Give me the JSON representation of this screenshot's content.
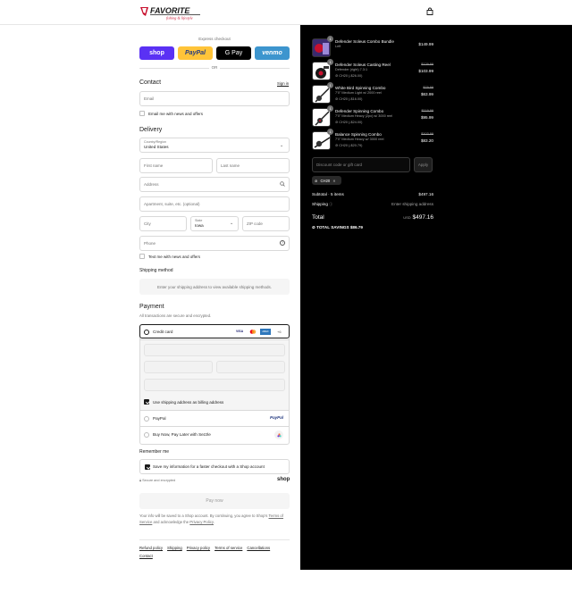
{
  "header": {
    "brand": "FAVORITE",
    "brand_sub": "fishing & lifestyle",
    "cart_icon": "bag-icon"
  },
  "express": {
    "label": "Express checkout",
    "buttons": [
      {
        "label": "shop",
        "color": "#5a31f4"
      },
      {
        "label": "PayPal",
        "color": "#ffc439"
      },
      {
        "label": "G Pay",
        "color": "#000000"
      },
      {
        "label": "venmo",
        "color": "#3d95ce"
      }
    ],
    "or": "OR"
  },
  "contact": {
    "title": "Contact",
    "signin": "Sign in",
    "email_placeholder": "Email",
    "news_label": "Email me with news and offers"
  },
  "delivery": {
    "title": "Delivery",
    "country_label": "Country/Region",
    "country_value": "United States",
    "first_name": "First name",
    "last_name": "Last name",
    "address": "Address",
    "apartment": "Apartment, suite, etc. (optional)",
    "city": "City",
    "state_label": "State",
    "state_value": "Iowa",
    "zip": "ZIP code",
    "phone": "Phone",
    "text_label": "Text me with news and offers"
  },
  "shipping": {
    "title": "Shipping method",
    "message": "Enter your shipping address to view available shipping methods."
  },
  "payment": {
    "title": "Payment",
    "subtitle": "All transactions are secure and encrypted.",
    "credit_card": "Credit card",
    "cards": [
      "VISA",
      "MC",
      "AMEX"
    ],
    "more": "+6",
    "billing_same": "Use shipping address as billing address",
    "paypal": "PayPal",
    "paypal_logo": "PayPal",
    "sezzle": "Buy Now, Pay Later with Sezzle"
  },
  "remember": {
    "title": "Remember me",
    "save_label": "Save my information for a faster checkout with a Shop account",
    "secure": "Secure and encrypted",
    "shop_logo": "shop"
  },
  "pay_now": "Pay now",
  "fine_print": {
    "line1": "Your info will be saved to a Shop account. By continuing, you agree to Shop's",
    "terms": "Terms of Service",
    "middle": "and acknowledge the",
    "privacy": "Privacy Policy",
    "end": "."
  },
  "footer": {
    "links": [
      "Refund policy",
      "Shipping",
      "Privacy policy",
      "Terms of service",
      "Cancellations",
      "Contact"
    ]
  },
  "summary": {
    "items": [
      {
        "qty": "1",
        "name": "Defender Soleus Combo Bundle",
        "variant": "Left",
        "discount": "",
        "original": "",
        "price": "$149.99"
      },
      {
        "qty": "1",
        "name": "Defender Soleus Casting Reel",
        "variant": "Defender (right) 7.3:1",
        "discount": "CH20 (-$26.00)",
        "original": "$129.99",
        "price": "$103.99"
      },
      {
        "qty": "1",
        "name": "White Bird Spinning Combo",
        "variant": "7'0\" Medium Light w/ 2000 reel",
        "discount": "CH20 (-$16.00)",
        "original": "$79.99",
        "price": "$63.99"
      },
      {
        "qty": "1",
        "name": "Defender Spinning Combo",
        "variant": "7'0\" Medium Heavy (2pc) w/ 3000 reel",
        "discount": "CH20 (-$24.00)",
        "original": "$119.99",
        "price": "$95.99"
      },
      {
        "qty": "1",
        "name": "Balance Spinning Combo",
        "variant": "7'0\" Medium Heavy w/ 3000 reel",
        "discount": "CH20 (-$20.79)",
        "original": "$103.99",
        "price": "$83.20"
      }
    ],
    "discount_placeholder": "Discount code or gift card",
    "apply": "Apply",
    "chip_code": "CH20",
    "subtotal_label": "Subtotal · 5 items",
    "subtotal_value": "$497.16",
    "shipping_label": "Shipping",
    "shipping_value": "Enter shipping address",
    "total_label": "Total",
    "currency": "USD",
    "total_value": "$497.16",
    "savings_label": "TOTAL SAVINGS",
    "savings_value": "$86.79"
  }
}
